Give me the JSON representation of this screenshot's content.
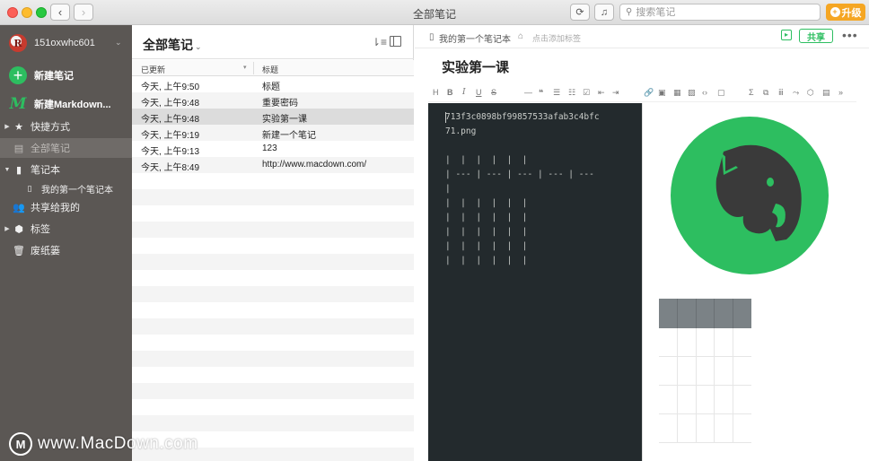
{
  "window": {
    "title": "全部笔记"
  },
  "toolbar": {
    "search_placeholder": "搜索笔记",
    "upgrade_label": "升级"
  },
  "sidebar": {
    "account": "151oxwhc601",
    "new_note": "新建笔记",
    "new_markdown": "新建Markdown...",
    "shortcuts": "快捷方式",
    "all_notes": "全部笔记",
    "notebooks": "笔记本",
    "my_notebook": "我的第一个笔记本",
    "shared": "共享给我的",
    "tags": "标签",
    "trash": "废纸篓"
  },
  "notelist": {
    "title": "全部笔记",
    "col_updated": "已更新",
    "col_title": "标题",
    "rows": [
      {
        "time": "今天, 上午9:50",
        "title": "标题"
      },
      {
        "time": "今天, 上午9:48",
        "title": "重要密码"
      },
      {
        "time": "今天, 上午9:48",
        "title": "实验第一课"
      },
      {
        "time": "今天, 上午9:19",
        "title": "新建一个笔记"
      },
      {
        "time": "今天, 上午9:13",
        "title": "123"
      },
      {
        "time": "今天, 上午8:49",
        "title": "http://www.macdown.com/"
      }
    ],
    "selected_index": 2
  },
  "editor": {
    "notebook": "我的第一个笔记本",
    "add_tag": "点击添加标签",
    "share": "共享",
    "title": "实验第一课",
    "markdown": "713f3c0898bf99857533afab3c4bfc\n71.png\n\n|  |  |  |  |  |\n| --- | --- | --- | --- | ---\n|\n|  |  |  |  |  |\n|  |  |  |  |  |\n|  |  |  |  |  |\n|  |  |  |  |  |\n|  |  |  |  |  |"
  },
  "watermark": {
    "text": "www.MacDown.com",
    "badge": "M"
  },
  "colors": {
    "accent": "#2dbe60",
    "sidebar_bg": "#5b5754",
    "editor_bg": "#232a2d",
    "upgrade": "#f5a623"
  }
}
